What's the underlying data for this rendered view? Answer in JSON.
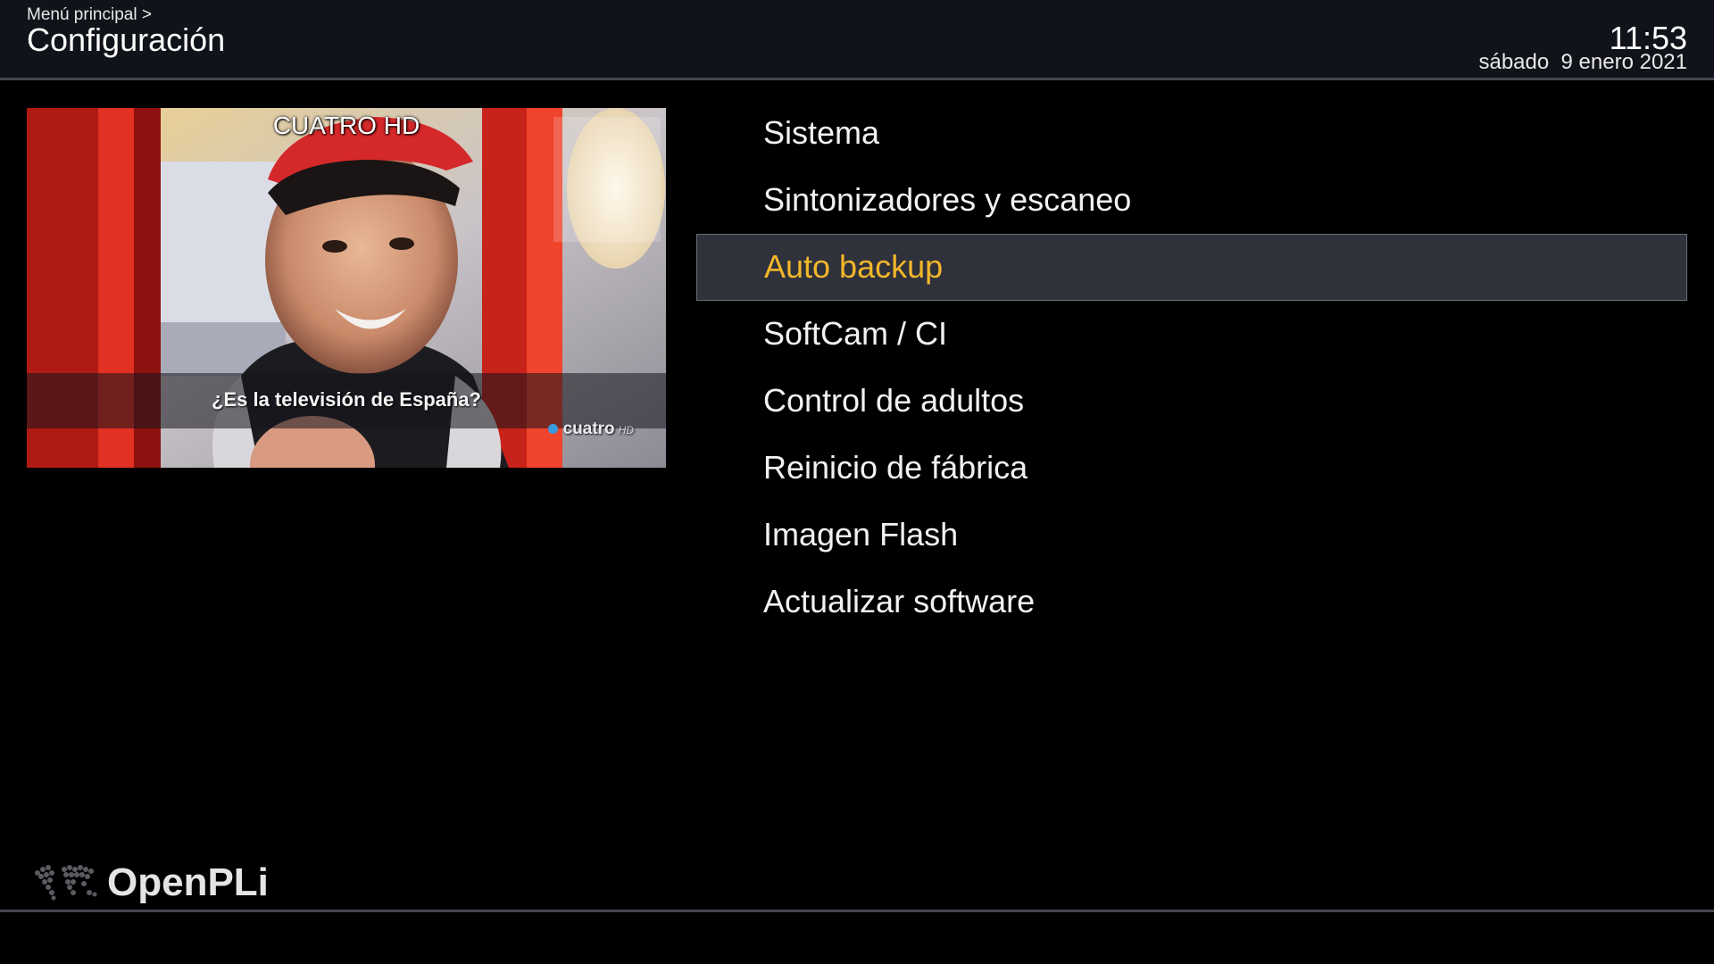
{
  "header": {
    "breadcrumb": "Menú principal >",
    "title": "Configuración",
    "time": "11:53",
    "date": "sábado  9 enero 2021"
  },
  "preview": {
    "channel_name": "CUATRO HD",
    "subtitle": "¿Es la televisión de España?",
    "watermark_name": "cuatro",
    "watermark_hd": "HD"
  },
  "menu": {
    "items": [
      {
        "label": "Sistema",
        "selected": false
      },
      {
        "label": "Sintonizadores y escaneo",
        "selected": false
      },
      {
        "label": "Auto backup",
        "selected": true
      },
      {
        "label": "SoftCam / CI",
        "selected": false
      },
      {
        "label": "Control de adultos",
        "selected": false
      },
      {
        "label": "Reinicio de fábrica",
        "selected": false
      },
      {
        "label": "Imagen Flash",
        "selected": false
      },
      {
        "label": "Actualizar software",
        "selected": false
      }
    ]
  },
  "footer": {
    "brand": "OpenPLi",
    "logo_icon": "world-map-icon"
  },
  "colors": {
    "background": "#000000",
    "header_bg": "#11131a",
    "selection_bg": "#2f313b",
    "selection_text": "#f2b72a",
    "text": "#f2f2f2"
  }
}
